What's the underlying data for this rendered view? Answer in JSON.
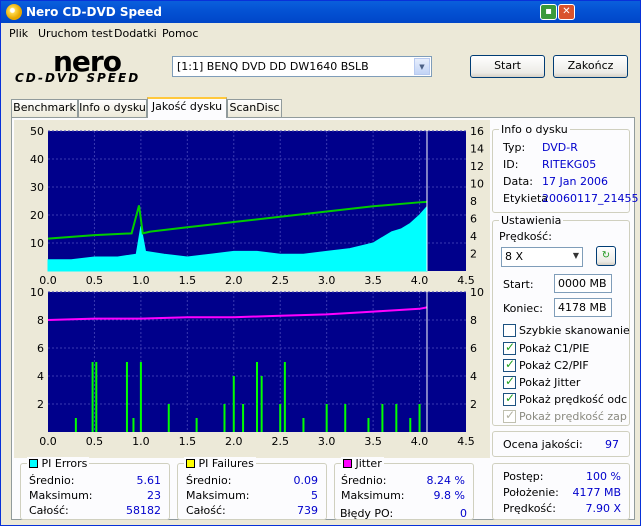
{
  "window": {
    "title": "Nero CD-DVD Speed"
  },
  "menu": [
    "Plik",
    "Uruchom test",
    "Dodatki",
    "Pomoc"
  ],
  "logo": {
    "top": "nero",
    "bottom": "CD-DVD SPEED"
  },
  "drive": {
    "selected": "[1:1]  BENQ DVD DD DW1640 BSLB"
  },
  "buttons": {
    "start": "Start",
    "stop": "Zakończ"
  },
  "tabs": [
    "Benchmark",
    "Info o dysku",
    "Jakość dysku",
    "ScanDisc"
  ],
  "active_tab": 2,
  "disc_info": {
    "title": "Info o dysku",
    "rows": [
      {
        "label": "Typ:",
        "value": "DVD-R"
      },
      {
        "label": "ID:",
        "value": "RITEKG05"
      },
      {
        "label": "Data:",
        "value": "17 Jan 2006"
      },
      {
        "label": "Etykieta",
        "value": "20060117_21455"
      }
    ]
  },
  "settings": {
    "title": "Ustawienia",
    "speed_label": "Prędkość:",
    "speed_value": "8 X",
    "start_label": "Start:",
    "start_value": "0000 MB",
    "end_label": "Koniec:",
    "end_value": "4178 MB",
    "checkboxes": [
      {
        "label": "Szybkie skanowanie",
        "checked": false,
        "disabled": false
      },
      {
        "label": "Pokaż C1/PIE",
        "checked": true,
        "disabled": false
      },
      {
        "label": "Pokaż C2/PIF",
        "checked": true,
        "disabled": false
      },
      {
        "label": "Pokaż Jitter",
        "checked": true,
        "disabled": false
      },
      {
        "label": "Pokaż prędkość odczy",
        "checked": true,
        "disabled": false
      },
      {
        "label": "Pokaż prędkość zapisu",
        "checked": true,
        "disabled": true
      }
    ]
  },
  "quality": {
    "label": "Ocena jakości:",
    "value": "97"
  },
  "pi_errors": {
    "title": "PI Errors",
    "color": "#00ffff",
    "rows": [
      {
        "label": "Średnio:",
        "value": "5.61"
      },
      {
        "label": "Maksimum:",
        "value": "23"
      },
      {
        "label": "Całość:",
        "value": "58182"
      }
    ]
  },
  "pi_failures": {
    "title": "PI Failures",
    "color": "#ffff00",
    "rows": [
      {
        "label": "Średnio:",
        "value": "0.09"
      },
      {
        "label": "Maksimum:",
        "value": "5"
      },
      {
        "label": "Całość:",
        "value": "739"
      }
    ]
  },
  "jitter": {
    "title": "Jitter",
    "color": "#ff00ff",
    "rows": [
      {
        "label": "Średnio:",
        "value": "8.24 %"
      },
      {
        "label": "Maksimum:",
        "value": "9.8 %"
      }
    ],
    "po_label": "Błędy PO:",
    "po_value": "0"
  },
  "progress": {
    "rows": [
      {
        "label": "Postęp:",
        "value": "100 %"
      },
      {
        "label": "Położenie:",
        "value": "4177 MB"
      },
      {
        "label": "Prędkość:",
        "value": "7.90 X"
      }
    ]
  },
  "chart_data": [
    {
      "type": "area",
      "name": "PI Errors (C1/PIE) with read speed",
      "x_ticks": [
        "0.0",
        "0.5",
        "1.0",
        "1.5",
        "2.0",
        "2.5",
        "3.0",
        "3.5",
        "4.0",
        "4.5"
      ],
      "xlim": [
        0,
        4.5
      ],
      "ylim_left": [
        0,
        50
      ],
      "y_ticks_left": [
        "10",
        "20",
        "30",
        "40",
        "50"
      ],
      "ylim_right": [
        0,
        16
      ],
      "y_ticks_right": [
        "2",
        "4",
        "6",
        "8",
        "10",
        "12",
        "14",
        "16"
      ],
      "end_marker": 4.08,
      "series": [
        {
          "name": "PI Errors",
          "color": "#00ffff",
          "x": [
            0.0,
            0.25,
            0.5,
            0.75,
            0.95,
            1.0,
            1.05,
            1.25,
            1.5,
            1.75,
            2.0,
            2.25,
            2.5,
            2.75,
            3.0,
            3.25,
            3.5,
            3.6,
            3.7,
            3.8,
            3.9,
            4.0,
            4.08
          ],
          "values": [
            4,
            4,
            5,
            5,
            6,
            16,
            7,
            6,
            5,
            6,
            7,
            7,
            6,
            6,
            7,
            8,
            10,
            12,
            14,
            15,
            17,
            20,
            23
          ]
        },
        {
          "name": "Read speed (X)",
          "color": "#00cc00",
          "axis": "right",
          "x": [
            0.0,
            0.5,
            0.9,
            0.98,
            1.02,
            1.1,
            1.5,
            2.0,
            2.5,
            3.0,
            3.5,
            4.0,
            4.08
          ],
          "values": [
            3.7,
            4.1,
            4.3,
            7.5,
            4.3,
            4.5,
            5.0,
            5.6,
            6.2,
            6.8,
            7.4,
            7.85,
            7.9
          ]
        }
      ]
    },
    {
      "type": "bar",
      "name": "PI Failures (C2/PIF) with jitter",
      "x_ticks": [
        "0.0",
        "0.5",
        "1.0",
        "1.5",
        "2.0",
        "2.5",
        "3.0",
        "3.5",
        "4.0",
        "4.5"
      ],
      "xlim": [
        0,
        4.5
      ],
      "ylim_left": [
        0,
        10
      ],
      "y_ticks_left": [
        "2",
        "4",
        "6",
        "8",
        "10"
      ],
      "ylim_right": [
        0,
        10
      ],
      "y_ticks_right": [
        "2",
        "4",
        "6",
        "8",
        "10"
      ],
      "end_marker": 4.08,
      "series": [
        {
          "name": "PI Failures",
          "color": "#00ff00",
          "x": [
            0.3,
            0.48,
            0.52,
            0.85,
            0.92,
            1.0,
            1.3,
            1.6,
            1.9,
            2.0,
            2.1,
            2.25,
            2.3,
            2.5,
            2.55,
            2.75,
            3.0,
            3.2,
            3.45,
            3.6,
            3.75,
            3.9,
            4.0
          ],
          "values": [
            1,
            5,
            5,
            5,
            1,
            5,
            2,
            1,
            2,
            4,
            2,
            5,
            4,
            2,
            5,
            1,
            2,
            2,
            1,
            2,
            2,
            1,
            2
          ]
        },
        {
          "name": "Jitter (%)",
          "color": "#ff00ff",
          "axis": "right",
          "x": [
            0.0,
            0.5,
            1.0,
            1.5,
            2.0,
            2.5,
            3.0,
            3.5,
            4.0,
            4.08
          ],
          "values": [
            8.0,
            8.1,
            8.1,
            8.2,
            8.2,
            8.3,
            8.4,
            8.6,
            8.8,
            8.9
          ]
        }
      ]
    }
  ]
}
